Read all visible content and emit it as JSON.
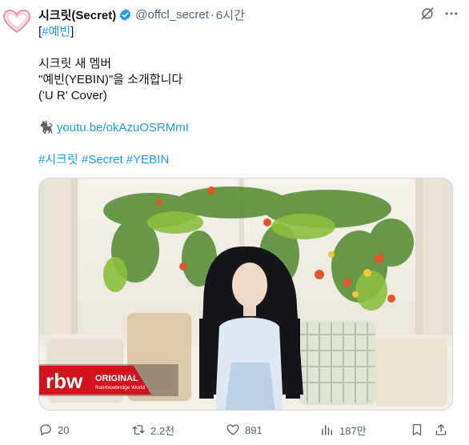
{
  "tweet": {
    "author": {
      "name": "시크릿(Secret)",
      "handle": "@offcl_secret",
      "time": "6시간",
      "separator": "·"
    },
    "lines": [
      "[#예빈]",
      "",
      "시크릿 새 멤버",
      "\"예빈(YEBIN)\"을 소개합니다",
      "('U R' Cover)",
      "",
      "youtu.be/okAzuOSRMmI",
      "",
      "#시크릿 #Secret #YEBIN"
    ],
    "tag_open": "[",
    "tag": "#예빈",
    "tag_close": "]",
    "line1": "시크릿 새 멤버",
    "line2": "\"예빈(YEBIN)\"을 소개합니다",
    "line3": "('U R' Cover)",
    "link_emoji": "🐈‍⬛",
    "link": "youtu.be/okAzuOSRMmI",
    "hashtags": [
      "#시크릿",
      "#Secret",
      "#YEBIN"
    ],
    "media": {
      "logo_text": "rbw",
      "badge_title": "ORIGINAL",
      "badge_sub": "Rainbowbridge World"
    }
  },
  "actions": {
    "reply": "20",
    "repost": "2.2천",
    "like": "891",
    "views": "187만"
  },
  "icons": {
    "avatar": "heart-logo-icon",
    "verified": "verified-badge-icon",
    "grok": "grok-icon",
    "more": "more-dots-icon",
    "reply": "reply-icon",
    "repost": "repost-icon",
    "like": "heart-icon",
    "views": "views-icon",
    "bookmark": "bookmark-icon",
    "share": "share-icon"
  },
  "colors": {
    "link": "#1d9bf0",
    "verified": "#1d9bf0",
    "muted": "#536471",
    "badge_red": "#d3121c"
  }
}
